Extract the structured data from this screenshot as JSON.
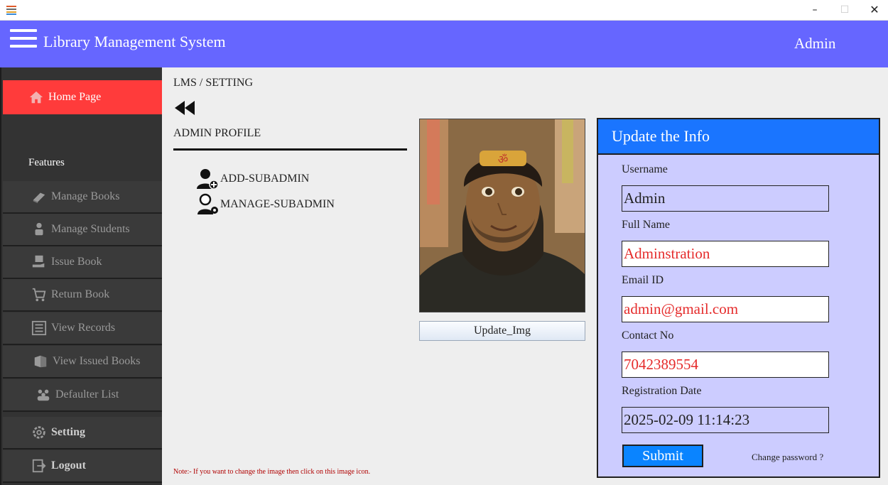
{
  "window": {
    "minimize": "–",
    "maximize": "☐",
    "close": "✕"
  },
  "header": {
    "title": "Library Management System",
    "user": "Admin"
  },
  "sidebar": {
    "home": "Home Page",
    "features_label": "Features",
    "items": [
      {
        "label": "Manage Books",
        "icon": "book-icon"
      },
      {
        "label": "Manage Students",
        "icon": "student-icon"
      },
      {
        "label": "Issue Book",
        "icon": "issue-book-icon"
      },
      {
        "label": "Return Book",
        "icon": "cart-icon"
      },
      {
        "label": "View Records",
        "icon": "list-icon"
      },
      {
        "label": "View Issued Books",
        "icon": "books-icon"
      },
      {
        "label": "Defaulter List",
        "icon": "people-icon"
      }
    ],
    "setting": "Setting",
    "logout": "Logout"
  },
  "main": {
    "breadcrumb": "LMS / SETTING",
    "section_title": "ADMIN PROFILE",
    "links": {
      "add_subadmin": "ADD-SUBADMIN",
      "manage_subadmin": "MANAGE-SUBADMIN"
    },
    "update_img_button": "Update_Img",
    "note": "Note:- If you want to change the image then click on this image icon."
  },
  "panel": {
    "title": "Update the Info",
    "username_label": "Username",
    "username_value": "Admin",
    "fullname_label": "Full Name",
    "fullname_value": "Adminstration",
    "email_label": "Email ID",
    "email_value": "admin@gmail.com",
    "contact_label": "Contact No",
    "contact_value": "7042389554",
    "regdate_label": "Registration Date",
    "regdate_value": "2025-02-09 11:14:23",
    "submit": "Submit",
    "change_password": "Change password ?"
  },
  "colors": {
    "header": "#6666ff",
    "home_active": "#ff3b3b",
    "panel_bg": "#ccccff",
    "panel_head": "#1a75ff",
    "input_text": "#e52b2b"
  }
}
